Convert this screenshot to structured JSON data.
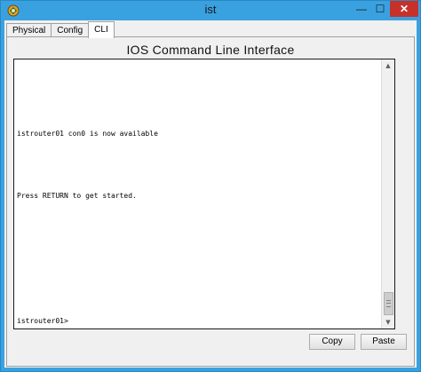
{
  "window": {
    "title": "ist",
    "minimize_glyph": "—",
    "maximize_glyph": "☐",
    "close_glyph": "✕"
  },
  "tabs": [
    {
      "label": "Physical",
      "active": false
    },
    {
      "label": "Config",
      "active": false
    },
    {
      "label": "CLI",
      "active": true
    }
  ],
  "panel": {
    "title": "IOS Command Line Interface"
  },
  "terminal": {
    "lines": [
      "istrouter01 con0 is now available",
      "Press RETURN to get started.",
      "istrouter01>"
    ]
  },
  "scrollbar": {
    "up_glyph": "▲",
    "down_glyph": "▼",
    "position": 0.93
  },
  "buttons": {
    "copy_label": "Copy",
    "paste_label": "Paste"
  },
  "colors": {
    "title_bar": "#3aa1e0",
    "close_button": "#c7312a",
    "terminal_background": "#ffffff"
  },
  "icons": {
    "app": "packet-tracer-icon"
  }
}
